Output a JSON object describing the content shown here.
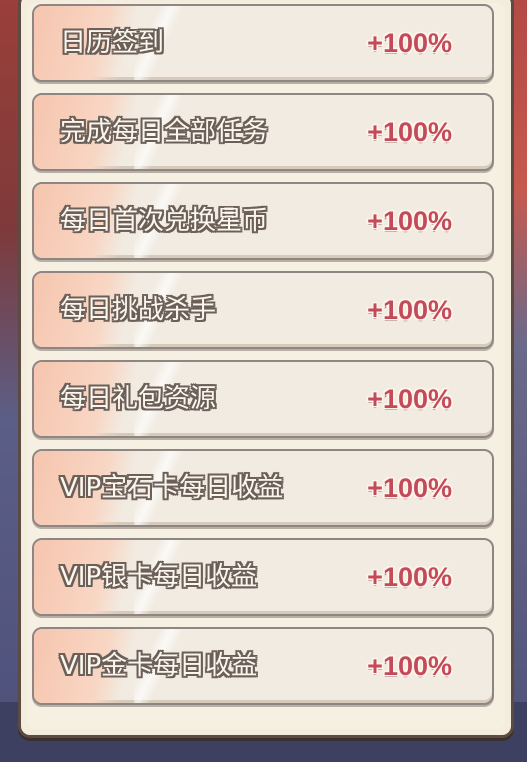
{
  "rows": [
    {
      "label": "日历签到",
      "value": "+100%"
    },
    {
      "label": "完成每日全部任务",
      "value": "+100%"
    },
    {
      "label": "每日首次兑换星币",
      "value": "+100%"
    },
    {
      "label": "每日挑战杀手",
      "value": "+100%"
    },
    {
      "label": "每日礼包资源",
      "value": "+100%"
    },
    {
      "label": "VIP宝石卡每日收益",
      "value": "+100%"
    },
    {
      "label": "VIP银卡每日收益",
      "value": "+100%"
    },
    {
      "label": "VIP金卡每日收益",
      "value": "+100%"
    }
  ],
  "colors": {
    "panel_bg": "#f4ecdc",
    "value_text": "#c24a5a",
    "row_accent": "#f6c5ae"
  }
}
